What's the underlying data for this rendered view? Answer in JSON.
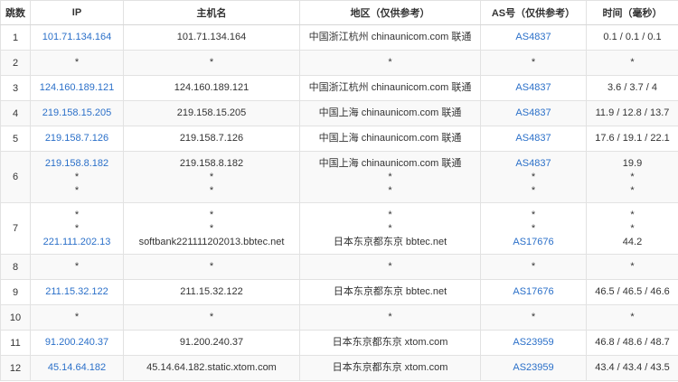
{
  "columns": {
    "hop": "跳数",
    "ip": "IP",
    "host": "主机名",
    "region": "地区（仅供参考）",
    "as": "AS号（仅供参考）",
    "time": "时间（毫秒）"
  },
  "rows": [
    {
      "hop": "1",
      "ip": [
        "101.71.134.164"
      ],
      "host": [
        "101.71.134.164"
      ],
      "region": [
        "中国浙江杭州 chinaunicom.com 联通"
      ],
      "as": [
        "AS4837"
      ],
      "time": [
        "0.1 / 0.1 / 0.1"
      ]
    },
    {
      "hop": "2",
      "ip": [
        "*"
      ],
      "host": [
        "*"
      ],
      "region": [
        "*"
      ],
      "as": [
        "*"
      ],
      "time": [
        "*"
      ]
    },
    {
      "hop": "3",
      "ip": [
        "124.160.189.121"
      ],
      "host": [
        "124.160.189.121"
      ],
      "region": [
        "中国浙江杭州 chinaunicom.com 联通"
      ],
      "as": [
        "AS4837"
      ],
      "time": [
        "3.6 / 3.7 / 4"
      ]
    },
    {
      "hop": "4",
      "ip": [
        "219.158.15.205"
      ],
      "host": [
        "219.158.15.205"
      ],
      "region": [
        "中国上海 chinaunicom.com 联通"
      ],
      "as": [
        "AS4837"
      ],
      "time": [
        "11.9 / 12.8 / 13.7"
      ]
    },
    {
      "hop": "5",
      "ip": [
        "219.158.7.126"
      ],
      "host": [
        "219.158.7.126"
      ],
      "region": [
        "中国上海 chinaunicom.com 联通"
      ],
      "as": [
        "AS4837"
      ],
      "time": [
        "17.6 / 19.1 / 22.1"
      ]
    },
    {
      "hop": "6",
      "ip": [
        "219.158.8.182",
        "*",
        "*"
      ],
      "host": [
        "219.158.8.182",
        "*",
        "*"
      ],
      "region": [
        "中国上海 chinaunicom.com 联通",
        "*",
        "*"
      ],
      "as": [
        "AS4837",
        "*",
        "*"
      ],
      "time": [
        "19.9",
        "*",
        "*"
      ]
    },
    {
      "hop": "7",
      "ip": [
        "*",
        "*",
        "221.111.202.13"
      ],
      "host": [
        "*",
        "*",
        "softbank221111202013.bbtec.net"
      ],
      "region": [
        "*",
        "*",
        "日本东京都东京 bbtec.net"
      ],
      "as": [
        "*",
        "*",
        "AS17676"
      ],
      "time": [
        "*",
        "*",
        "44.2"
      ]
    },
    {
      "hop": "8",
      "ip": [
        "*"
      ],
      "host": [
        "*"
      ],
      "region": [
        "*"
      ],
      "as": [
        "*"
      ],
      "time": [
        "*"
      ]
    },
    {
      "hop": "9",
      "ip": [
        "211.15.32.122"
      ],
      "host": [
        "211.15.32.122"
      ],
      "region": [
        "日本东京都东京 bbtec.net"
      ],
      "as": [
        "AS17676"
      ],
      "time": [
        "46.5 / 46.5 / 46.6"
      ]
    },
    {
      "hop": "10",
      "ip": [
        "*"
      ],
      "host": [
        "*"
      ],
      "region": [
        "*"
      ],
      "as": [
        "*"
      ],
      "time": [
        "*"
      ]
    },
    {
      "hop": "11",
      "ip": [
        "91.200.240.37"
      ],
      "host": [
        "91.200.240.37"
      ],
      "region": [
        "日本东京都东京 xtom.com"
      ],
      "as": [
        "AS23959"
      ],
      "time": [
        "46.8 / 48.6 / 48.7"
      ]
    },
    {
      "hop": "12",
      "ip": [
        "45.14.64.182"
      ],
      "host": [
        "45.14.64.182.static.xtom.com"
      ],
      "region": [
        "日本东京都东京 xtom.com"
      ],
      "as": [
        "AS23959"
      ],
      "time": [
        "43.4 / 43.4 / 43.5"
      ]
    }
  ],
  "colors": {
    "link": "#2b70c9",
    "text": "#333333",
    "border": "#e2e2e2",
    "stripe": "#f9f9f9"
  }
}
